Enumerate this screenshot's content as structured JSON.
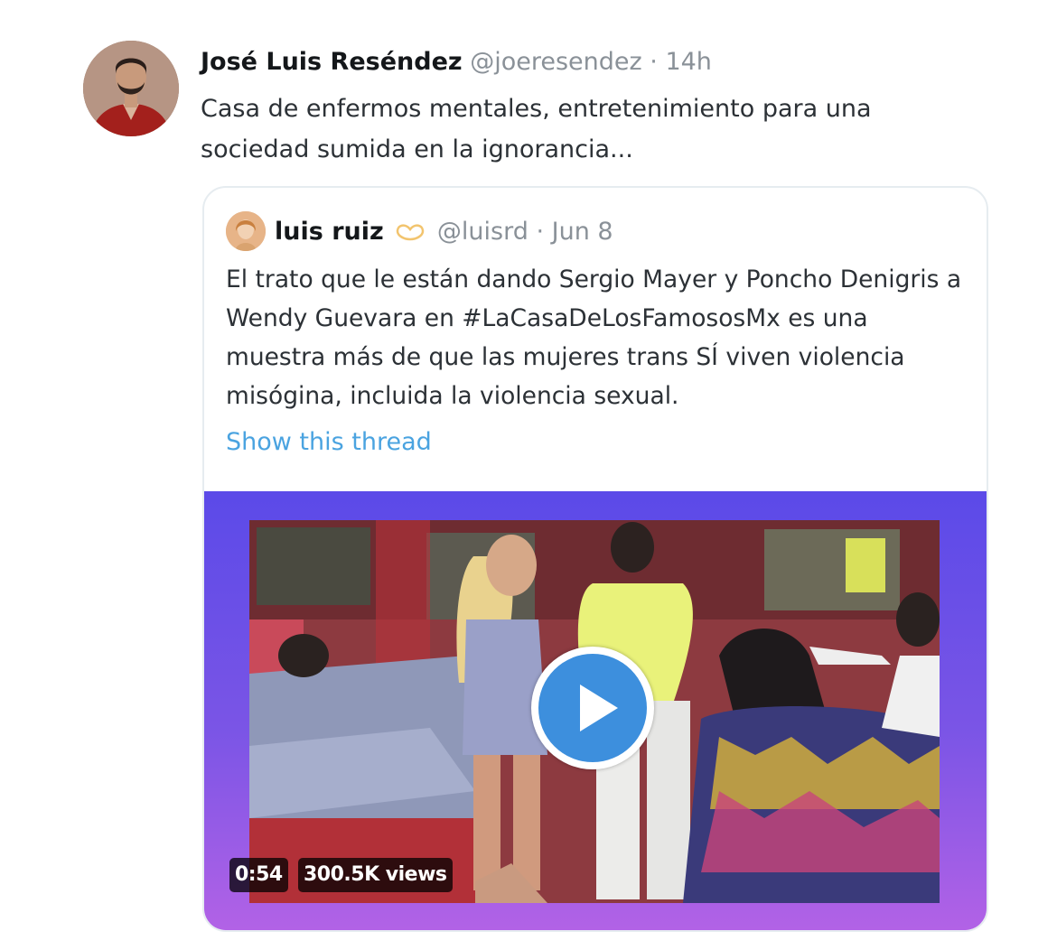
{
  "tweet": {
    "name": "José Luis Reséndez",
    "handle": "@joeresendez",
    "separator": "·",
    "time": "14h",
    "text": "Casa de enfermos mentales, entretenimiento para una sociedad sumida en la ignorancia..."
  },
  "quoted": {
    "name": "luis ruiz",
    "badge_icon": "heart-hands-emoji",
    "handle": "@luisrd",
    "separator": "·",
    "date": "Jun 8",
    "text": "El trato que le están dando Sergio Mayer y Poncho Denigris a Wendy Guevara en #LaCasaDeLosFamososMx es una muestra más de que las mujeres trans SÍ viven violencia misógina, incluida la violencia sexual.",
    "show_thread": "Show this thread",
    "video": {
      "duration": "0:54",
      "views": "300.5K views",
      "play_icon": "play-icon"
    }
  },
  "colors": {
    "link": "#4aa3e0",
    "play_button": "#3d8fdd",
    "media_gradient_top": "#5b4ae8",
    "media_gradient_bottom": "#b262e6"
  }
}
